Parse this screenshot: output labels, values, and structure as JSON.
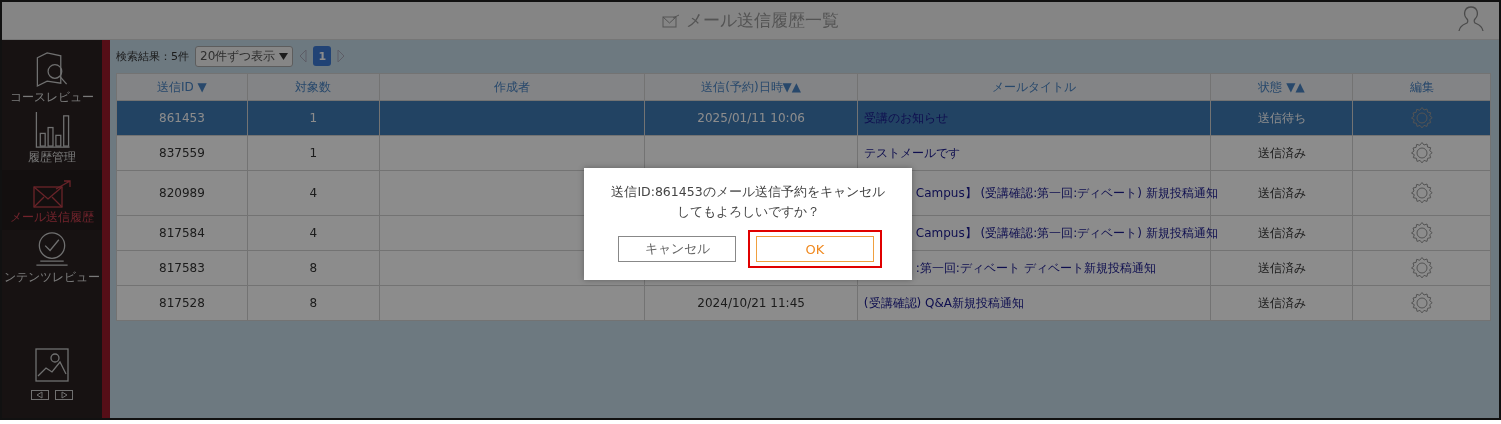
{
  "header": {
    "title": "メール送信履歴一覧"
  },
  "sidebar": {
    "items": [
      {
        "label": "コースレビュー",
        "kind": "book",
        "selected": false
      },
      {
        "label": "履歴管理",
        "kind": "chart",
        "selected": false
      },
      {
        "label": "メール送信履歴",
        "kind": "mail",
        "selected": true
      },
      {
        "label": "ンテンツレビュー",
        "kind": "check",
        "selected": false
      }
    ]
  },
  "toolbar": {
    "result": "検索結果：5件",
    "per_page": "20件ずつ表示",
    "pages": [
      {
        "label": "1",
        "selected": true
      }
    ]
  },
  "table": {
    "columns": [
      "送信ID ▼",
      "対象数",
      "作成者",
      "送信(予約)日時▼▲",
      "メールタイトル",
      "状態 ▼▲",
      "編集"
    ],
    "rows": [
      {
        "id": "861453",
        "count": "1",
        "date": "2025/01/11 10:06",
        "title": "受講のお知らせ",
        "status": "送信待ち",
        "selected": true
      },
      {
        "id": "837559",
        "count": "1",
        "title": "テストメールです",
        "status": "送信済み",
        "selected": false
      },
      {
        "id": "820989",
        "count": "4",
        "title": "Campus】 (受講確認:第一回:ディベート) 新規投稿通知",
        "status": "送信済み",
        "selected": false
      },
      {
        "id": "817584",
        "count": "4",
        "title": "Campus】 (受講確認:第一回:ディベート) 新規投稿通知",
        "status": "送信済み",
        "selected": false
      },
      {
        "id": "817583",
        "count": "8",
        "title": ":第一回:ディベート ディベート新規投稿通知",
        "status": "送信済み",
        "selected": false
      },
      {
        "id": "817528",
        "count": "8",
        "date": "2024/10/21 11:45",
        "title": "(受講確認) Q&A新規投稿通知",
        "status": "送信済み",
        "selected": false
      }
    ]
  },
  "dialog": {
    "message": "送信ID:861453のメール送信予約をキャンセルしてもよろしいですか？",
    "buttons": [
      {
        "label": "キャンセル",
        "kind": "cancel",
        "highlighted": false
      },
      {
        "label": "OK",
        "kind": "ok",
        "highlighted": true
      }
    ]
  }
}
